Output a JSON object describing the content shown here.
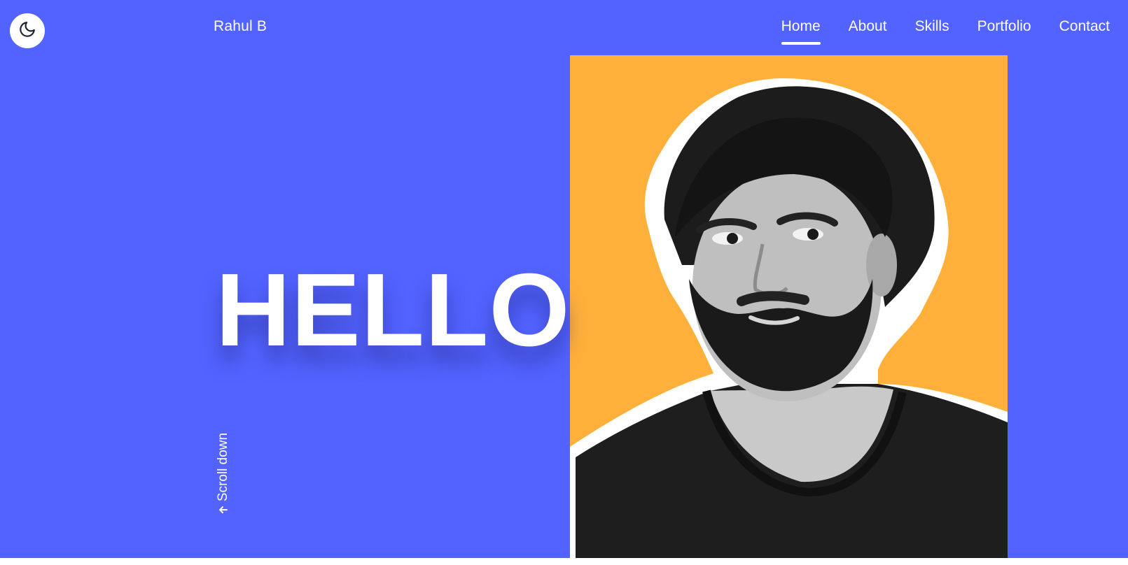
{
  "header": {
    "theme_toggle_icon": "moon-icon",
    "brand": "Rahul B",
    "nav": [
      {
        "label": "Home",
        "active": true
      },
      {
        "label": "About",
        "active": false
      },
      {
        "label": "Skills",
        "active": false
      },
      {
        "label": "Portfolio",
        "active": false
      },
      {
        "label": "Contact",
        "active": false
      }
    ]
  },
  "hero": {
    "greeting": "HELLO",
    "scroll_label": "Scroll down",
    "scroll_icon": "arrow-down-icon",
    "portrait_image": "portrait-photo"
  },
  "colors": {
    "hero_background": "#5263ff",
    "photo_background": "#ffb03b",
    "text": "#ffffff"
  }
}
